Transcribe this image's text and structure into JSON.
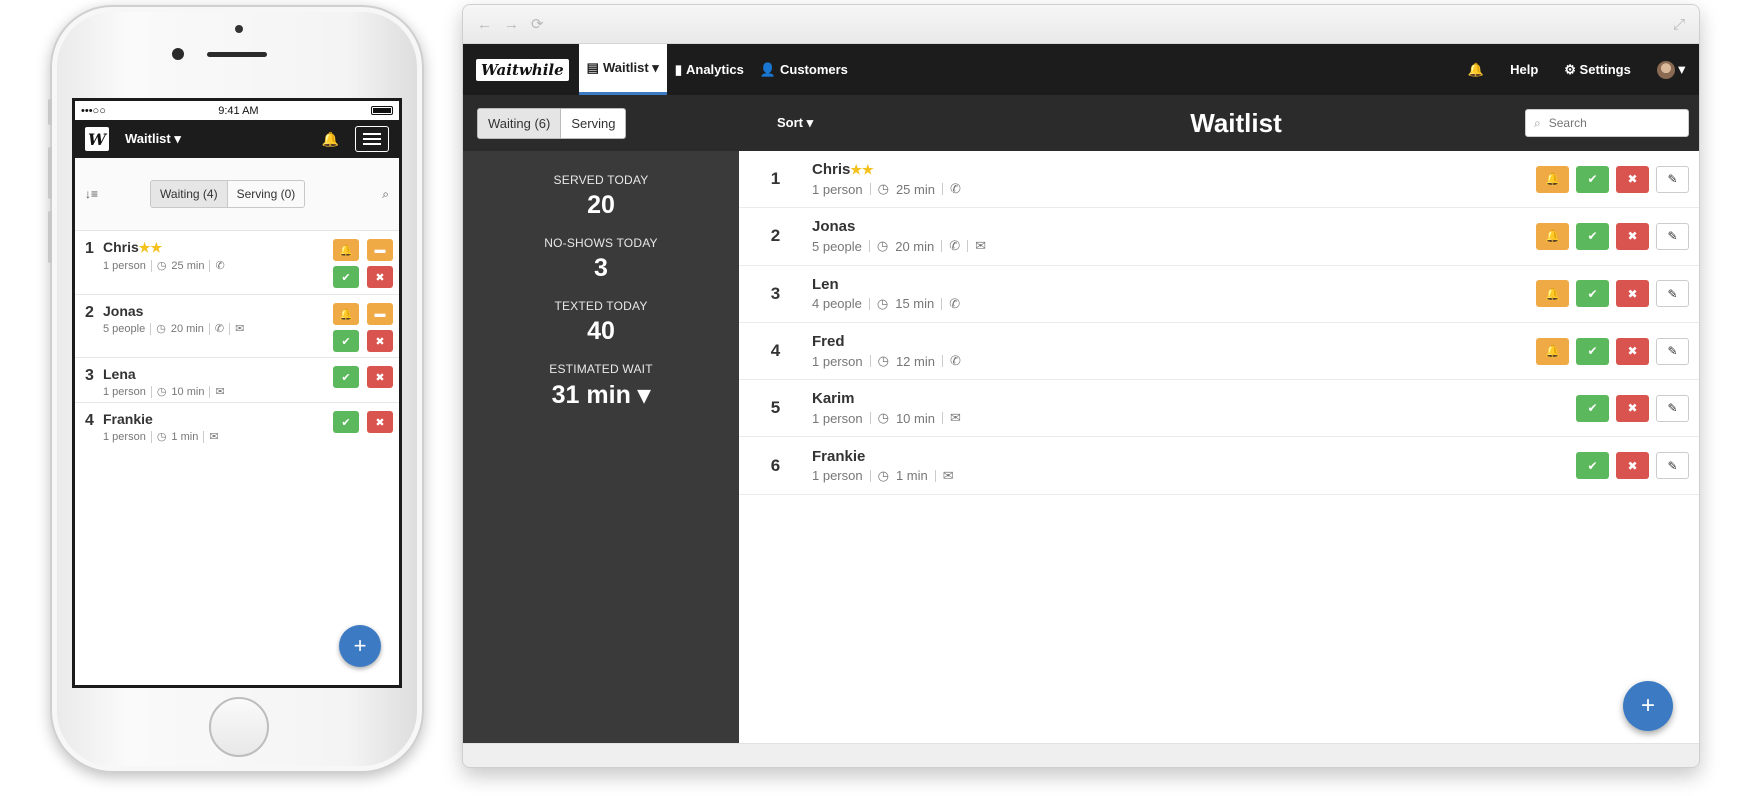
{
  "colors": {
    "accent": "#3c7bc4",
    "notify": "#efa945",
    "serve": "#5cb85c",
    "remove": "#d9534f",
    "nav": "#1c1c1c",
    "stats_panel": "#3a3a3a"
  },
  "icons": {
    "bell": "bell-icon",
    "check": "check-icon",
    "remove": "close-icon",
    "edit": "pencil-icon",
    "phone": "phone-icon",
    "email": "envelope-icon",
    "clock": "clock-icon",
    "chat": "chat-icon",
    "add": "plus-icon"
  },
  "mobile": {
    "status": {
      "carrier": "•••○○",
      "time": "9:41 AM"
    },
    "nav": {
      "logo": "W",
      "title": "Waitlist ▾"
    },
    "tabs": {
      "waiting": "Waiting (4)",
      "serving": "Serving (0)"
    },
    "rows": [
      {
        "num": "1",
        "name": "Chris",
        "stars": "★★",
        "size": "1 person",
        "wait": "25 min"
      },
      {
        "num": "2",
        "name": "Jonas",
        "stars": "",
        "size": "5 people",
        "wait": "20 min"
      },
      {
        "num": "3",
        "name": "Lena",
        "stars": "",
        "size": "1 person",
        "wait": "10 min"
      },
      {
        "num": "4",
        "name": "Frankie",
        "stars": "",
        "size": "1 person",
        "wait": "1 min"
      }
    ],
    "fab": "+"
  },
  "desktop": {
    "nav": {
      "logo": "Waitwhile",
      "waitlist": "Waitlist ▾",
      "analytics": "Analytics",
      "customers": "Customers",
      "help": "Help",
      "settings": "Settings"
    },
    "tabs": {
      "waiting": "Waiting (6)",
      "serving": "Serving"
    },
    "sort": "Sort ▾",
    "title": "Waitlist",
    "search_placeholder": "Search",
    "stats": [
      {
        "label": "SERVED TODAY",
        "value": "20"
      },
      {
        "label": "NO-SHOWS TODAY",
        "value": "3"
      },
      {
        "label": "TEXTED TODAY",
        "value": "40"
      },
      {
        "label": "ESTIMATED WAIT",
        "value": "31 min ▾"
      }
    ],
    "rows": [
      {
        "num": "1",
        "name": "Chris",
        "stars": "★★",
        "size": "1 person",
        "wait": "25 min"
      },
      {
        "num": "2",
        "name": "Jonas",
        "stars": "",
        "size": "5 people",
        "wait": "20 min"
      },
      {
        "num": "3",
        "name": "Len",
        "stars": "",
        "size": "4 people",
        "wait": "15 min"
      },
      {
        "num": "4",
        "name": "Fred",
        "stars": "",
        "size": "1 person",
        "wait": "12 min"
      },
      {
        "num": "5",
        "name": "Karim",
        "stars": "",
        "size": "1 person",
        "wait": "10 min"
      },
      {
        "num": "6",
        "name": "Frankie",
        "stars": "",
        "size": "1 person",
        "wait": "1 min"
      }
    ],
    "fab": "+"
  }
}
